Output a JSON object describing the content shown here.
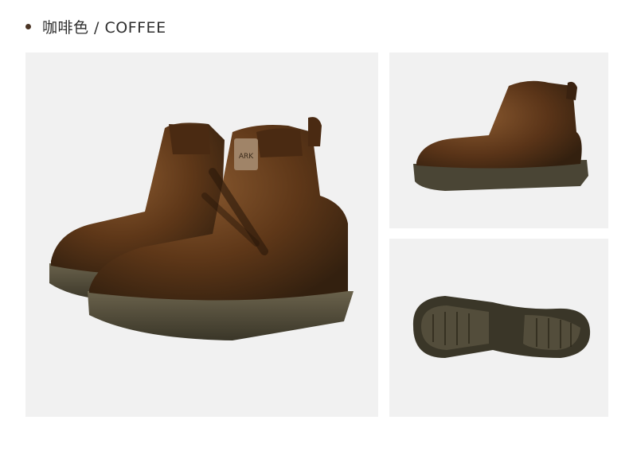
{
  "header": {
    "bullet_color": "#4a3424",
    "title": "咖啡色 / COFFEE"
  },
  "product": {
    "boot_color": "#5a3418",
    "sole_color": "#4a4535",
    "panel_bg": "#f1f1f1",
    "tag_text": "ARK"
  }
}
